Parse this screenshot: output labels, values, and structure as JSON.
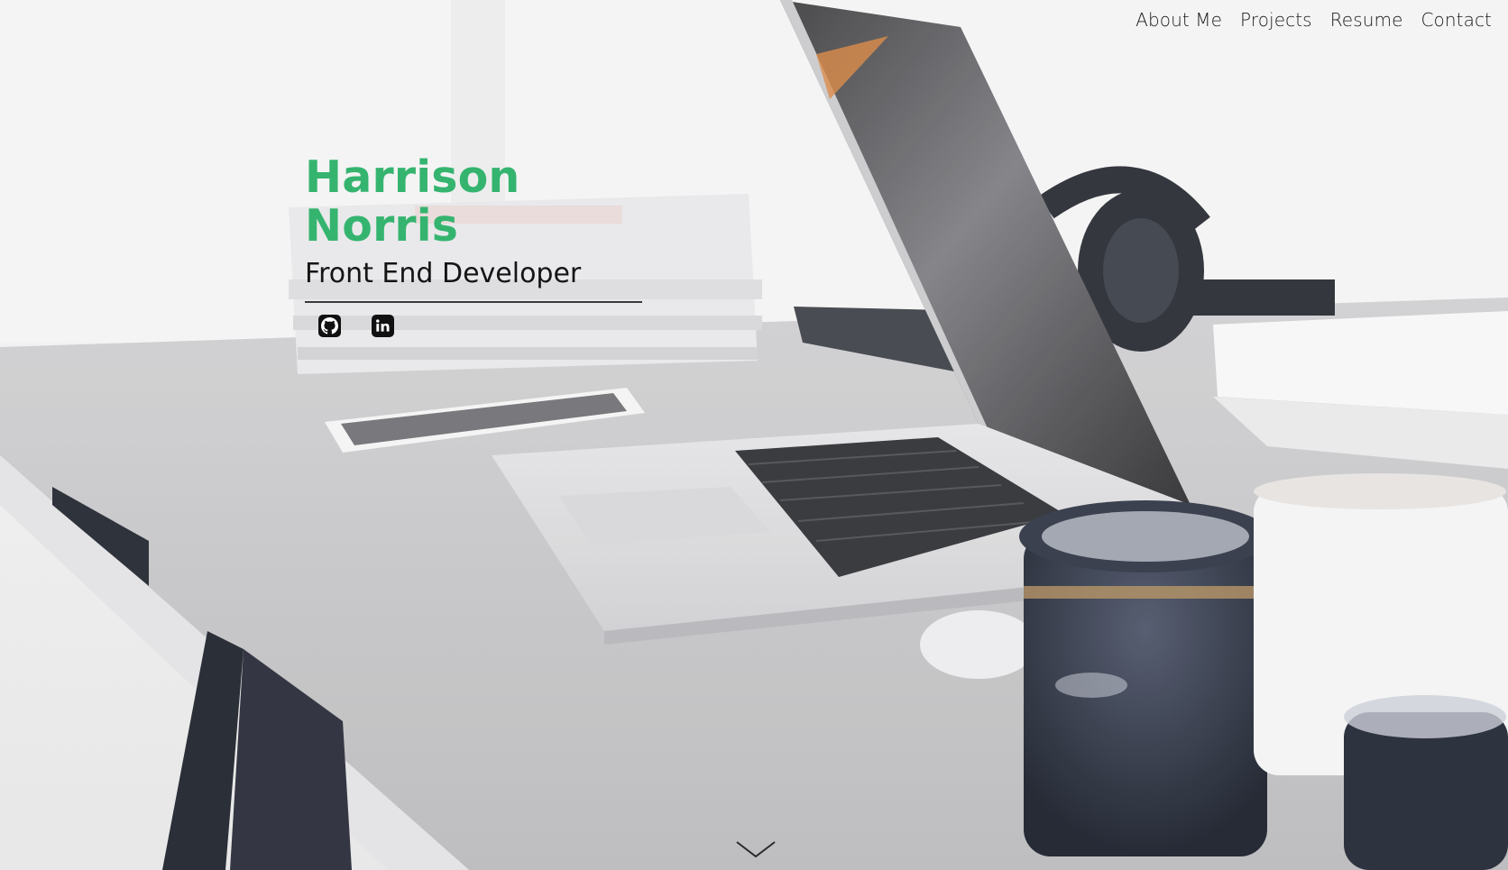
{
  "nav": {
    "items": [
      {
        "label": "About Me"
      },
      {
        "label": "Projects"
      },
      {
        "label": "Resume"
      },
      {
        "label": "Contact"
      }
    ]
  },
  "hero": {
    "name": "Harrison Norris",
    "role": "Front End Developer",
    "accent_color": "#35b46f",
    "background_scene": "desk-with-laptop-photo"
  },
  "social": [
    {
      "icon": "github-icon"
    },
    {
      "icon": "linkedin-icon"
    }
  ],
  "scroll_icon": "chevron-down-icon"
}
